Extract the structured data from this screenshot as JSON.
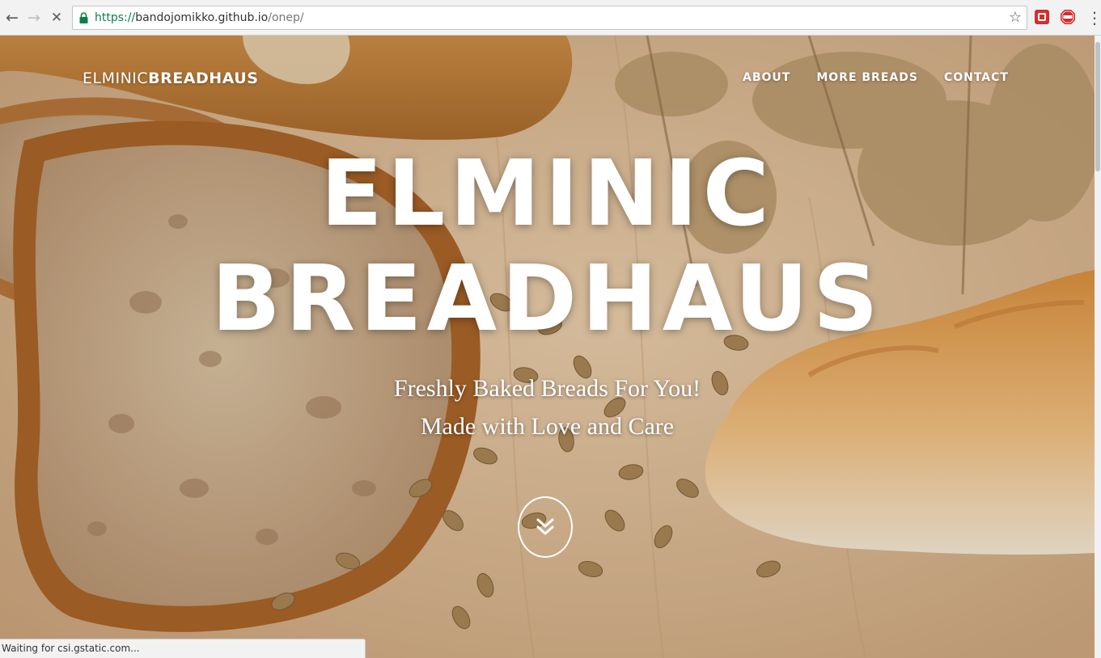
{
  "browser": {
    "url_scheme": "https://",
    "url_host": "bandojomikko.github.io",
    "url_path": "/onep/",
    "back_icon": "←",
    "forward_icon": "→",
    "stop_icon": "✕",
    "star_icon": "☆",
    "menu_icon": "⋮",
    "status_text": "Waiting for csi.gstatic.com..."
  },
  "site": {
    "brand_part1": "ELMINIC",
    "brand_part2": "BREADHAUS",
    "nav": {
      "about": "ABOUT",
      "more_breads": "MORE BREADS",
      "contact": "CONTACT"
    },
    "headline_line1": "ELMINIC",
    "headline_line2": "BREADHAUS",
    "tagline_line1": "Freshly Baked Breads For You!",
    "tagline_line2": "Made with Love and Care"
  },
  "colors": {
    "accent_text": "#ffffff",
    "secure_green": "#0b8043",
    "bread_crust": "#c07a36",
    "wood_background": "#d8b790"
  }
}
